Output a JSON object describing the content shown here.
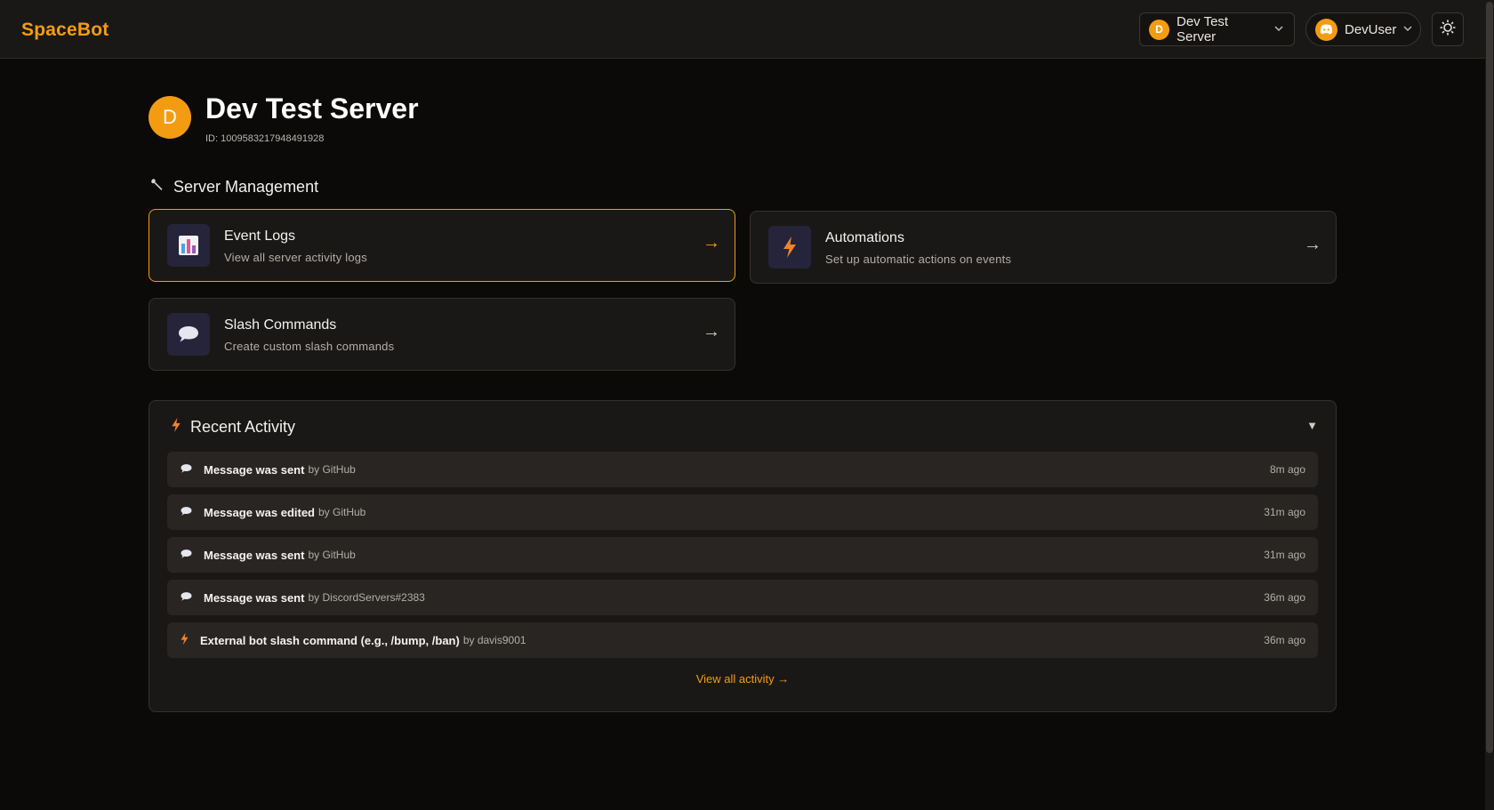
{
  "app": {
    "brand": "SpaceBot"
  },
  "header": {
    "server_selector": {
      "avatar_letter": "D",
      "label": "Dev Test Server"
    },
    "user_menu": {
      "label": "DevUser"
    }
  },
  "server": {
    "avatar_letter": "D",
    "name": "Dev Test Server",
    "id_text": "ID: 1009583217948491928"
  },
  "management": {
    "title": "Server Management",
    "cards": [
      {
        "title": "Event Logs",
        "desc": "View all server activity logs",
        "arrow": "→"
      },
      {
        "title": "Automations",
        "desc": "Set up automatic actions on events",
        "arrow": "→"
      },
      {
        "title": "Slash Commands",
        "desc": "Create custom slash commands",
        "arrow": "→"
      }
    ]
  },
  "activity": {
    "title": "Recent Activity",
    "toggle": "▼",
    "items": [
      {
        "icon": "speech-bubble-icon",
        "title": "Message was sent",
        "by": "by GitHub",
        "time": "8m ago"
      },
      {
        "icon": "speech-bubble-icon",
        "title": "Message was edited",
        "by": "by GitHub",
        "time": "31m ago"
      },
      {
        "icon": "speech-bubble-icon",
        "title": "Message was sent",
        "by": "by GitHub",
        "time": "31m ago"
      },
      {
        "icon": "speech-bubble-icon",
        "title": "Message was sent",
        "by": "by DiscordServers#2383",
        "time": "36m ago"
      },
      {
        "icon": "lightning-icon",
        "title": "External bot slash command (e.g., /bump, /ban)",
        "by": "by davis9001",
        "time": "36m ago"
      }
    ],
    "view_all": "View all activity →"
  },
  "colors": {
    "accent": "#f39c12",
    "background": "#0b0a09",
    "card": "#1a1816"
  }
}
